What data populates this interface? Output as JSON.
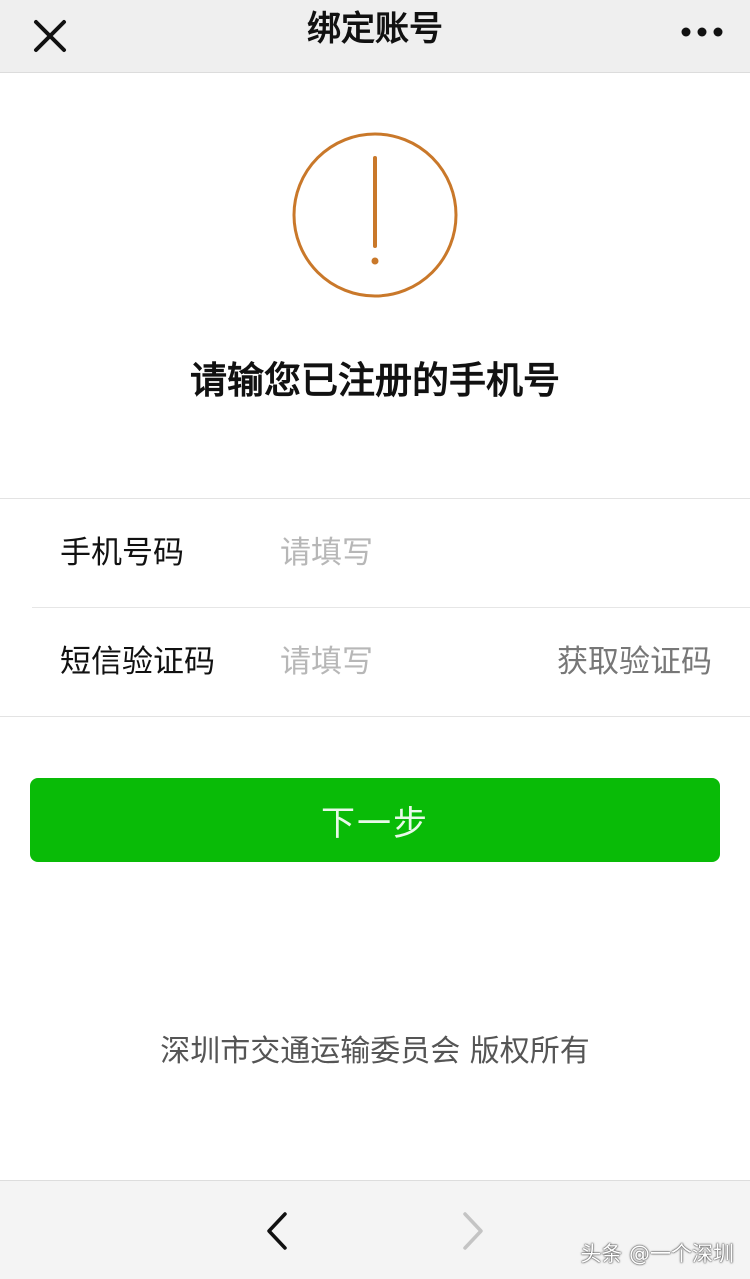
{
  "navbar": {
    "title": "绑定账号",
    "close_icon": "close-icon",
    "more_icon": "more-dots-icon"
  },
  "warning": {
    "icon": "exclamation-circle-icon",
    "color": "#c9782a",
    "headline": "请输您已注册的手机号"
  },
  "form": {
    "phone": {
      "label": "手机号码",
      "value": "",
      "placeholder": "请填写"
    },
    "code": {
      "label": "短信验证码",
      "value": "",
      "placeholder": "请填写",
      "action": "获取验证码"
    }
  },
  "next_button": {
    "label": "下一步",
    "color": "#09bb07"
  },
  "footer": {
    "copyright": "深圳市交通运输委员会 版权所有"
  },
  "toolbar": {
    "back_icon": "chevron-left-icon",
    "forward_icon": "chevron-right-icon"
  },
  "watermark": "头条 @一个深圳"
}
